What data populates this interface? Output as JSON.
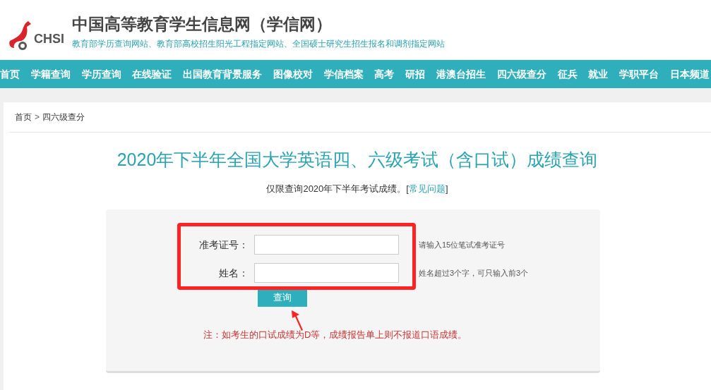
{
  "header": {
    "logo_text": "CHSI",
    "title": "中国高等教育学生信息网（学信网）",
    "tagline": "教育部学历查询网站、教育部高校招生阳光工程指定网站、全国硕士研究生招生报名和调剂指定网站"
  },
  "nav": [
    "首页",
    "学籍查询",
    "学历查询",
    "在线验证",
    "出国教育背景服务",
    "图像校对",
    "学信档案",
    "高考",
    "研招",
    "港澳台招生",
    "四六级查分",
    "征兵",
    "就业",
    "学职平台",
    "日本频道"
  ],
  "breadcrumb": {
    "items": [
      "首页",
      "四六级查分"
    ],
    "separator": ">"
  },
  "page_title": "2020年下半年全国大学英语四、六级考试（含口试）成绩查询",
  "subtitle": {
    "before": "仅限查询2020年下半年考试成绩。[",
    "link": "常见问题",
    "after": "]"
  },
  "form": {
    "fields": [
      {
        "label": "准考证号：",
        "hint": "请输入15位笔试准考证号"
      },
      {
        "label": "姓名：",
        "hint": "姓名超过3个字，可只输入前3个"
      }
    ],
    "button": "查询",
    "note": "注：如考生的口试成绩为D等，成绩报告单上则不报道口语成绩。"
  }
}
